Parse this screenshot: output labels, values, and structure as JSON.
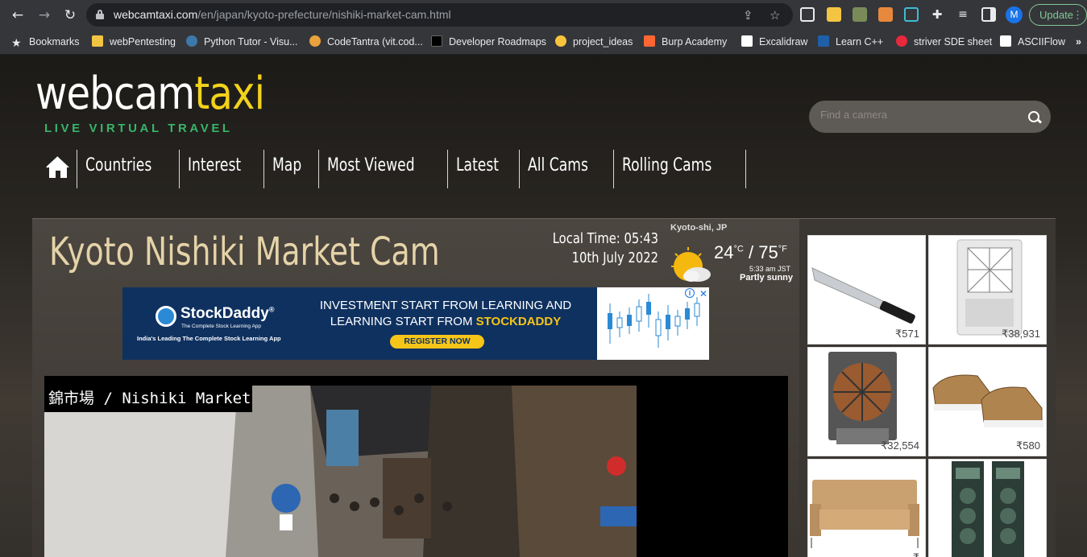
{
  "browser": {
    "url_host": "webcamtaxi.com",
    "url_path": "/en/japan/kyoto-prefecture/nishiki-market-cam.html",
    "profile_initial": "M",
    "update_label": "Update",
    "bookmarks": [
      {
        "label": "Bookmarks",
        "color": "#e8eaed"
      },
      {
        "label": "webPentesting",
        "color": "#f4c542"
      },
      {
        "label": "Python Tutor - Visu...",
        "color": "#3c78aa"
      },
      {
        "label": "CodeTantra (vit.cod...",
        "color": "#e8a23c"
      },
      {
        "label": "Developer Roadmaps",
        "color": "#000000"
      },
      {
        "label": "project_ideas",
        "color": "#f9c43c"
      },
      {
        "label": "Burp Academy",
        "color": "#ff6633"
      },
      {
        "label": "Excalidraw",
        "color": "#ffffff"
      },
      {
        "label": "Learn C++",
        "color": "#1f5fa8"
      },
      {
        "label": "striver SDE sheet",
        "color": "#e8283c"
      },
      {
        "label": "ASCIIFlow",
        "color": "#ffffff"
      }
    ],
    "more_label": "»"
  },
  "site": {
    "logo_part1": "webcam",
    "logo_part2": "taxi",
    "tagline": "LIVE VIRTUAL TRAVEL",
    "search_placeholder": "Find a camera",
    "nav": [
      "Countries",
      "Interest",
      "Map",
      "Most Viewed",
      "Latest",
      "All Cams",
      "Rolling Cams"
    ]
  },
  "cam": {
    "title": "Kyoto Nishiki Market Cam",
    "local_time": "Local Time: 05:43",
    "date": "10th July 2022",
    "video_label": "錦市場 / Nishiki Market"
  },
  "weather": {
    "location": "Kyoto-shi, JP",
    "temp_c": "24",
    "unit_c": "°C",
    "sep": "/",
    "temp_f": "75",
    "unit_f": "°F",
    "obs_time": "5:33 am JST",
    "condition": "Partly sunny"
  },
  "ad_banner": {
    "brand": "StockDaddy",
    "brand_mark": "®",
    "brand_sub": "The Complete Stock Learning App",
    "sub": "India's Leading The Complete Stock Learning App",
    "headline_1": "INVESTMENT START FROM LEARNING AND",
    "headline_2": "LEARNING START FROM ",
    "headline_hl": "STOCKDADDY",
    "cta": "REGISTER NOW"
  },
  "products": [
    {
      "name": "machete",
      "price": "₹571"
    },
    {
      "name": "air-cooler",
      "price": "₹38,931"
    },
    {
      "name": "industrial-cooler",
      "price": "₹32,554"
    },
    {
      "name": "shoes",
      "price": "₹580"
    },
    {
      "name": "sofa",
      "price": "₹"
    },
    {
      "name": "tower-speaker",
      "price": ""
    }
  ]
}
